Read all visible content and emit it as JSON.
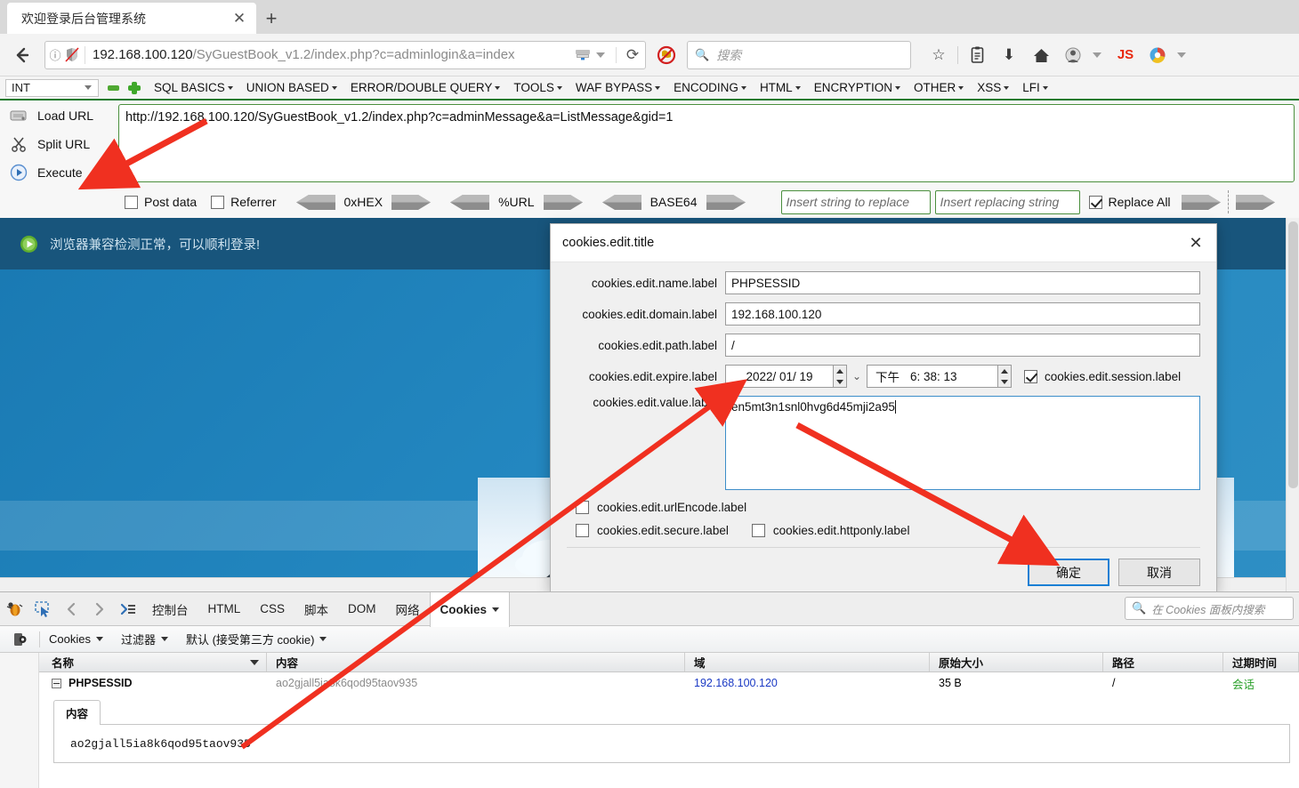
{
  "browser": {
    "tab": {
      "title": "欢迎登录后台管理系统",
      "close": "✕"
    },
    "newtab": "+",
    "back_icon": "←",
    "url": {
      "host": "192.168.100.120",
      "path": "/SyGuestBook_v1.2/index.php?c=adminlogin&a=index"
    },
    "reload": "⟳",
    "search_placeholder": "搜索",
    "icons": {
      "info": "ⓘ",
      "bookmark": "☆",
      "library": "▤",
      "download": "⬇",
      "home": "⌂",
      "js": "JS"
    }
  },
  "hackbar": {
    "type_select": "INT",
    "menus": [
      "SQL BASICS",
      "UNION BASED",
      "ERROR/DOUBLE QUERY",
      "TOOLS",
      "WAF BYPASS",
      "ENCODING",
      "HTML",
      "ENCRYPTION",
      "OTHER",
      "XSS",
      "LFI"
    ],
    "actions": [
      {
        "label": "Load URL",
        "accel_before": "Lo",
        "accel": "a",
        "accel_after": "d URL"
      },
      {
        "label": "Split URL",
        "accel_before": "",
        "accel": "S",
        "accel_after": "plit URL"
      },
      {
        "label": "Execute",
        "accel_before": "E",
        "accel": "x",
        "accel_after": "ecute"
      }
    ],
    "url_value": "http://192.168.100.120/SyGuestBook_v1.2/index.php?c=adminMessage&a=ListMessage&gid=1",
    "post_data": "Post data",
    "referrer": "Referrer",
    "encoders": [
      "0xHEX",
      "%URL",
      "BASE64"
    ],
    "replace_from_placeholder": "Insert string to replace",
    "replace_to_placeholder": "Insert replacing string",
    "replace_all": "Replace All",
    "post_data_checked": false,
    "referrer_checked": false,
    "replace_all_checked": true
  },
  "page": {
    "banner_text": "浏览器兼容检测正常，可以顺利登录!"
  },
  "dialog": {
    "title": "cookies.edit.title",
    "close": "✕",
    "fields": {
      "name": {
        "label": "cookies.edit.name.label",
        "value": "PHPSESSID"
      },
      "domain": {
        "label": "cookies.edit.domain.label",
        "value": "192.168.100.120"
      },
      "path": {
        "label": "cookies.edit.path.label",
        "value": "/"
      },
      "expire": {
        "label": "cookies.edit.expire.label",
        "date": "2022/ 01/ 19",
        "ampm": "下午",
        "time": "6: 38: 13",
        "session_label": "cookies.edit.session.label",
        "session_checked": true
      },
      "value": {
        "label": "cookies.edit.value.label",
        "value": "en5mt3n1snl0hvg6d45mji2a95"
      }
    },
    "checkboxes": {
      "urlEncode": {
        "label": "cookies.edit.urlEncode.label",
        "checked": false
      },
      "secure": {
        "label": "cookies.edit.secure.label",
        "checked": false
      },
      "httponly": {
        "label": "cookies.edit.httponly.label",
        "checked": false
      }
    },
    "buttons": {
      "ok": "确定",
      "cancel": "取消"
    }
  },
  "firebug": {
    "tabs": [
      "控制台",
      "HTML",
      "CSS",
      "脚本",
      "DOM",
      "网络"
    ],
    "active_tab": "Cookies",
    "search_placeholder": "在 Cookies 面板内搜索",
    "subbar": {
      "cookies_menu": "Cookies",
      "filter_menu": "过滤器",
      "default_menu": "默认 (接受第三方 cookie)"
    },
    "columns": [
      "名称",
      "内容",
      "域",
      "原始大小",
      "路径",
      "过期时间"
    ],
    "rows": [
      {
        "name": "PHPSESSID",
        "content": "ao2gjall5ia8k6qod95taov935",
        "domain": "192.168.100.120",
        "size": "35 B",
        "path": "/",
        "expire": "会话"
      }
    ],
    "detail": {
      "tab": "内容",
      "value": "ao2gjall5ia8k6qod95taov935"
    }
  },
  "colors": {
    "accent_green": "#1d7a2e",
    "page_blue": "#2387c0",
    "banner_blue": "#18557c",
    "annotation_red": "#f03020",
    "link_blue": "#1a39c4",
    "session_green": "#2aa02a"
  }
}
